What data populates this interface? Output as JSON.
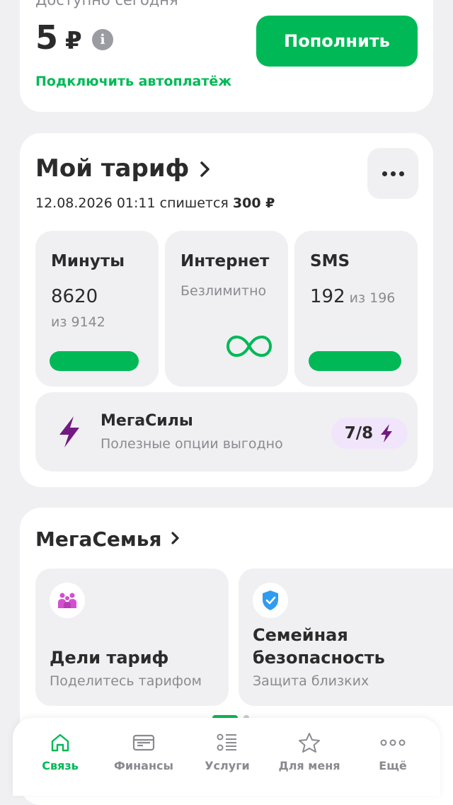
{
  "balance": {
    "available_label": "Доступно сегодня",
    "amount": "5",
    "currency": "₽",
    "topup_label": "Пополнить",
    "autopay_label": "Подключить автоплатёж"
  },
  "tariff": {
    "title": "Мой тариф",
    "charge_prefix": "12.08.2026 01:11 спишется",
    "charge_amount": "300 ₽",
    "tiles": {
      "minutes": {
        "name": "Минуты",
        "value": "8620",
        "sub": "из 9142",
        "fraction": 0.943
      },
      "internet": {
        "name": "Интернет",
        "status": "Безлимитно"
      },
      "sms": {
        "name": "SMS",
        "value": "192",
        "sub": "из 196",
        "fraction": 0.98
      }
    },
    "megasily": {
      "name": "МегаСилы",
      "sub": "Полезные опции выгодно",
      "count": "7/8"
    }
  },
  "family": {
    "title": "МегаСемья",
    "tiles": [
      {
        "name": "Дели тариф",
        "sub": "Поделитесь тарифом"
      },
      {
        "name": "Семейная безопасность",
        "sub": "Защита близких"
      }
    ]
  },
  "nav": {
    "items": [
      {
        "label": "Связь"
      },
      {
        "label": "Финансы"
      },
      {
        "label": "Услуги"
      },
      {
        "label": "Для меня"
      },
      {
        "label": "Ещё"
      }
    ]
  },
  "colors": {
    "accent": "#00b956",
    "purple": "#731982",
    "badge_bg": "#f1e5fb",
    "shield": "#2f9cf0",
    "family_icon": "#d44fd0"
  }
}
